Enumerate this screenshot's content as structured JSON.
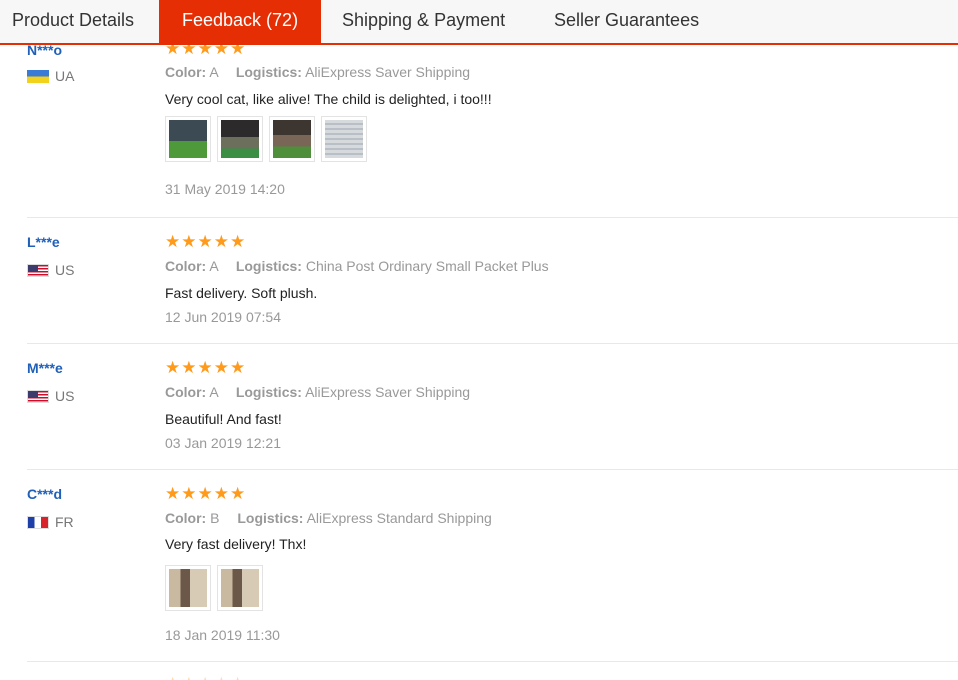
{
  "tabs": [
    {
      "label": "Product Details"
    },
    {
      "label": "Feedback (72)"
    },
    {
      "label": "Shipping & Payment"
    },
    {
      "label": "Seller Guarantees"
    }
  ],
  "labels": {
    "color": "Color:",
    "logistics": "Logistics:"
  },
  "reviews": [
    {
      "user": "N***o",
      "country": "UA",
      "stars": "★★★★★",
      "rating": 5,
      "color": "A",
      "logistics": "AliExpress Saver Shipping",
      "text": "Very cool cat, like alive! The child is delighted, i too!!!",
      "date": "31 May 2019 14:20",
      "photos": 4
    },
    {
      "user": "L***e",
      "country": "US",
      "stars": "★★★★★",
      "rating": 5,
      "color": "A",
      "logistics": "China Post Ordinary Small Packet Plus",
      "text": "Fast delivery. Soft plush.",
      "date": "12 Jun 2019 07:54",
      "photos": 0
    },
    {
      "user": "M***e",
      "country": "US",
      "stars": "★★★★★",
      "rating": 5,
      "color": "A",
      "logistics": "AliExpress Saver Shipping",
      "text": "Beautiful! And fast!",
      "date": "03 Jan 2019 12:21",
      "photos": 0
    },
    {
      "user": "C***d",
      "country": "FR",
      "stars": "★★★★★",
      "rating": 5,
      "color": "B",
      "logistics": "AliExpress Standard Shipping",
      "text": "Very fast delivery! Thx!",
      "date": "18 Jan 2019 11:30",
      "photos": 2
    }
  ],
  "next_stars": "★★★★★",
  "colors": {
    "accent": "#e62e04",
    "star": "#ff9a1b",
    "user": "#2060b8"
  }
}
